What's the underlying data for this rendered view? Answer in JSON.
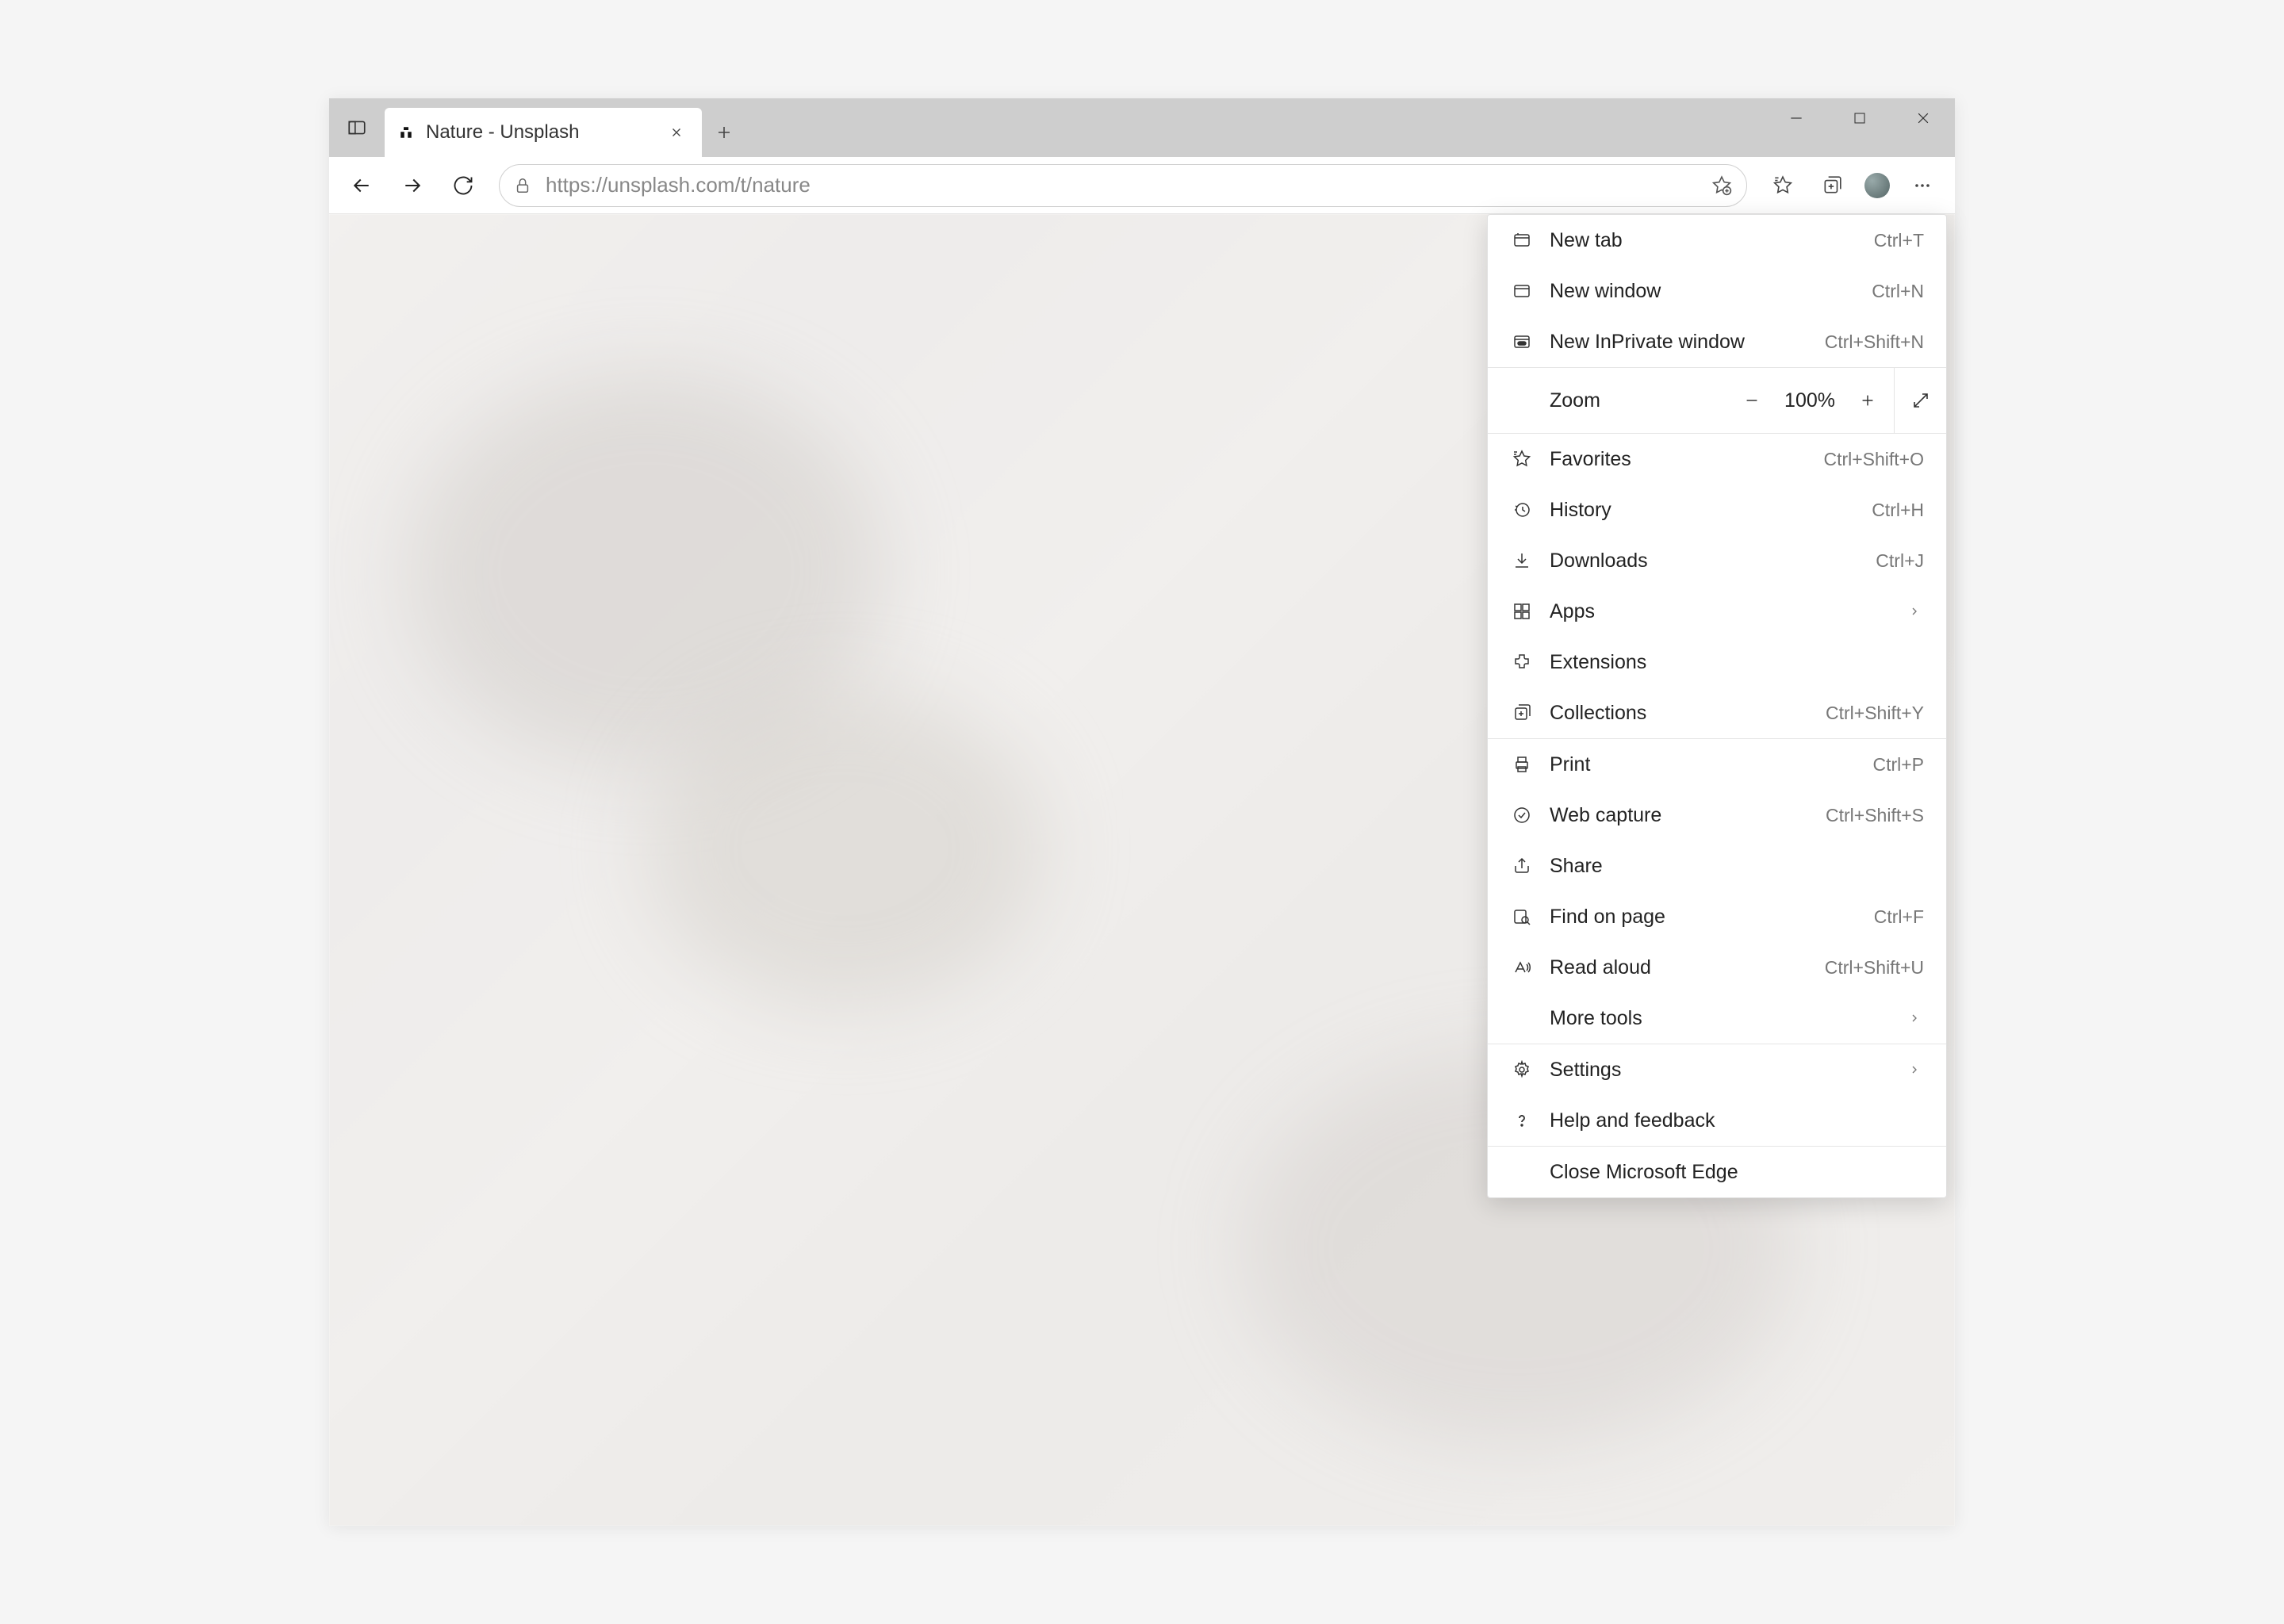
{
  "tab": {
    "title": "Nature - Unsplash"
  },
  "url": "https://unsplash.com/t/nature",
  "zoom": {
    "label": "Zoom",
    "value": "100%"
  },
  "menu": {
    "new_tab": {
      "label": "New tab",
      "shortcut": "Ctrl+T"
    },
    "new_window": {
      "label": "New window",
      "shortcut": "Ctrl+N"
    },
    "new_inprivate": {
      "label": "New InPrivate window",
      "shortcut": "Ctrl+Shift+N"
    },
    "favorites": {
      "label": "Favorites",
      "shortcut": "Ctrl+Shift+O"
    },
    "history": {
      "label": "History",
      "shortcut": "Ctrl+H"
    },
    "downloads": {
      "label": "Downloads",
      "shortcut": "Ctrl+J"
    },
    "apps": {
      "label": "Apps"
    },
    "extensions": {
      "label": "Extensions"
    },
    "collections": {
      "label": "Collections",
      "shortcut": "Ctrl+Shift+Y"
    },
    "print": {
      "label": "Print",
      "shortcut": "Ctrl+P"
    },
    "web_capture": {
      "label": "Web capture",
      "shortcut": "Ctrl+Shift+S"
    },
    "share": {
      "label": "Share"
    },
    "find": {
      "label": "Find on page",
      "shortcut": "Ctrl+F"
    },
    "read_aloud": {
      "label": "Read aloud",
      "shortcut": "Ctrl+Shift+U"
    },
    "more_tools": {
      "label": "More tools"
    },
    "settings": {
      "label": "Settings"
    },
    "help": {
      "label": "Help and feedback"
    },
    "close": {
      "label": "Close Microsoft Edge"
    }
  }
}
